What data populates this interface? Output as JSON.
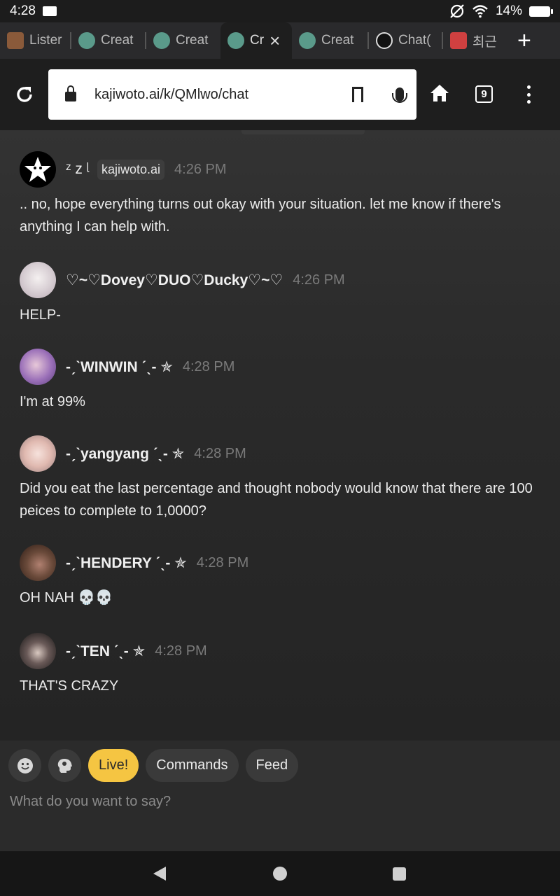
{
  "status": {
    "time": "4:28",
    "battery": "14%"
  },
  "tabs": [
    {
      "label": "Lister",
      "color": "#8a5a3a"
    },
    {
      "label": "Creat",
      "color": "#5a9a8a"
    },
    {
      "label": "Creat",
      "color": "#5a9a8a"
    },
    {
      "label": "Cr",
      "color": "#5a9a8a",
      "active": true
    },
    {
      "label": "Creat",
      "color": "#5a9a8a"
    },
    {
      "label": "Chat(",
      "color": "#000000"
    },
    {
      "label": "최근",
      "color": "#d04040"
    }
  ],
  "toolbar": {
    "url": "kajiwoto.ai/k/QMlwo/chat",
    "tab_count": "9"
  },
  "messages": [
    {
      "name": "ᶻ z ᶩ",
      "badge": "kajiwoto.ai",
      "time": "4:26 PM",
      "text": ".. no, hope everything turns out okay with your situation. let me know if there's anything I can help with."
    },
    {
      "name": "♡~♡Dovey♡DUO♡Ducky♡~♡",
      "time": "4:26 PM",
      "text": "HELP-"
    },
    {
      "name": "-ˏˋWINWIN ˊˎ- ✯",
      "time": "4:28 PM",
      "text": "I'm at 99%"
    },
    {
      "name": "-ˏˋyangyang ˊˎ- ✯",
      "time": "4:28 PM",
      "text": "Did you eat the last percentage and thought nobody would know that there are 100 peices to complete to 1,0000?"
    },
    {
      "name": "-ˏˋHENDERY ˊˎ- ✯",
      "time": "4:28 PM",
      "text": "OH NAH 💀💀"
    },
    {
      "name": "-ˏˋTEN ˊˎ- ✯",
      "time": "4:28 PM",
      "text": "THAT'S CRAZY"
    }
  ],
  "input": {
    "chips": {
      "live": "Live!",
      "commands": "Commands",
      "feed": "Feed"
    },
    "placeholder": "What do you want to say?"
  }
}
